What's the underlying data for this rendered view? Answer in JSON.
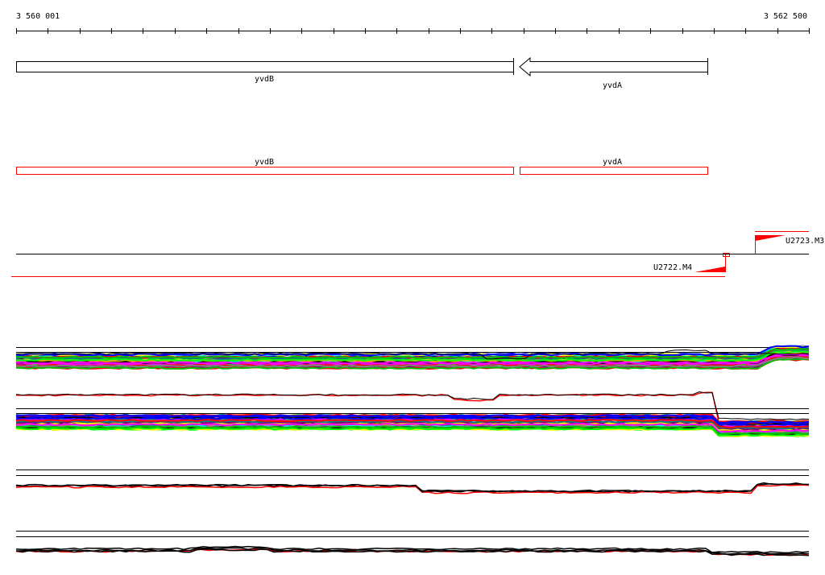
{
  "ruler": {
    "start_label": "3 560 001",
    "end_label": "3 562 500"
  },
  "genes_top": [
    {
      "name": "yvdB",
      "strand": "+"
    },
    {
      "name": "yvdA",
      "strand": "-"
    }
  ],
  "genes_red": [
    {
      "name": "yvdB"
    },
    {
      "name": "yvdA"
    }
  ],
  "promoters": [
    {
      "name": "U2723.M3",
      "strand": "+"
    },
    {
      "name": "U2722.M4",
      "strand": "-"
    }
  ],
  "colors": {
    "gene_red": "#ff0000",
    "black": "#000000"
  }
}
